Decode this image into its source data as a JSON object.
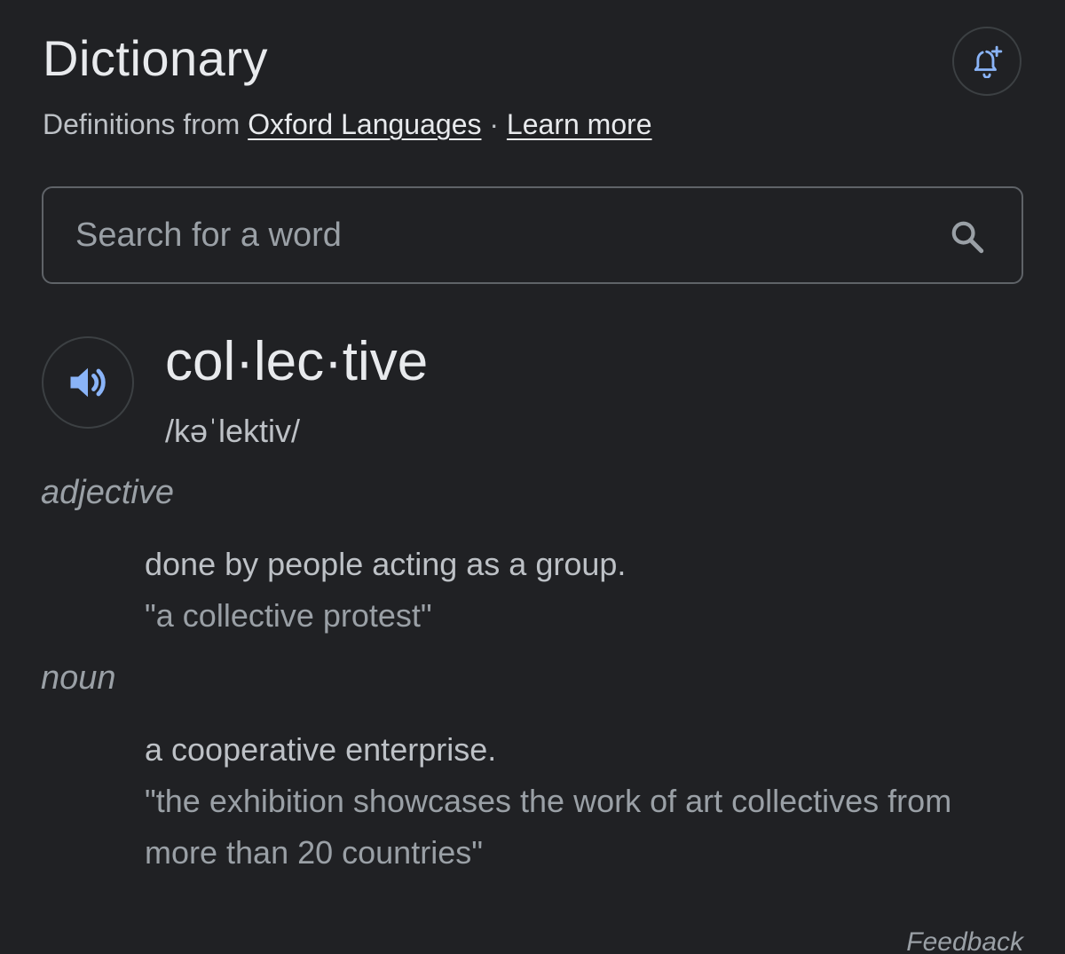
{
  "header": {
    "title": "Dictionary",
    "subtitle_prefix": "Definitions from ",
    "source_link": "Oxford Languages",
    "separator": " · ",
    "learn_more": "Learn more",
    "alert_icon": "add-alert-icon"
  },
  "search": {
    "placeholder": "Search for a word",
    "value": "",
    "icon": "search-icon"
  },
  "entry": {
    "headword": "col·lec·tive",
    "phonetic": "/kəˈlektiv/",
    "audio_icon": "speaker-icon",
    "senses": [
      {
        "part_of_speech": "adjective",
        "definition": "done by people acting as a group.",
        "example": "\"a collective protest\""
      },
      {
        "part_of_speech": "noun",
        "definition": "a cooperative enterprise.",
        "example": "\"the exhibition showcases the work of art collectives from more than 20 countries\""
      }
    ]
  },
  "footer": {
    "feedback": "Feedback"
  },
  "colors": {
    "background": "#202124",
    "text_primary": "#e8eaed",
    "text_secondary": "#bdc1c6",
    "text_muted": "#9aa0a6",
    "accent_blue": "#8ab4f8",
    "border": "#5f6368"
  }
}
